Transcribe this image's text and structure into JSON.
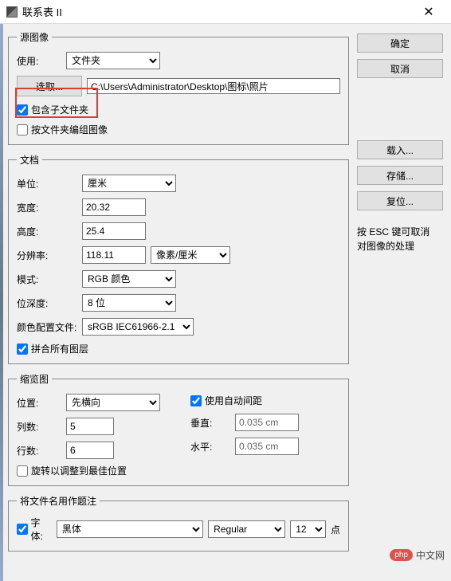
{
  "window": {
    "title": "联系表 II",
    "close": "✕"
  },
  "buttons": {
    "ok": "确定",
    "cancel": "取消",
    "load": "载入...",
    "save": "存储...",
    "reset": "复位...",
    "select": "选取..."
  },
  "hint": {
    "line1": "按 ESC 键可取消",
    "line2": "对图像的处理"
  },
  "source": {
    "legend": "源图像",
    "use_label": "使用:",
    "use_value": "文件夹",
    "path": "C:\\Users\\Administrator\\Desktop\\图标\\照片",
    "include_sub": "包含子文件夹",
    "group_by_folder": "按文件夹编组图像"
  },
  "doc": {
    "legend": "文档",
    "unit_label": "单位:",
    "unit_value": "厘米",
    "width_label": "宽度:",
    "width_value": "20.32",
    "height_label": "高度:",
    "height_value": "25.4",
    "res_label": "分辨率:",
    "res_value": "118.11",
    "res_unit": "像素/厘米",
    "mode_label": "模式:",
    "mode_value": "RGB 颜色",
    "depth_label": "位深度:",
    "depth_value": "8 位",
    "profile_label": "颜色配置文件:",
    "profile_value": "sRGB IEC61966-2.1",
    "flatten": "拼合所有图层"
  },
  "thumb": {
    "legend": "缩览图",
    "place_label": "位置:",
    "place_value": "先横向",
    "auto_spacing": "使用自动间距",
    "cols_label": "列数:",
    "cols_value": "5",
    "rows_label": "行数:",
    "rows_value": "6",
    "vert_label": "垂直:",
    "vert_value": "0.035 cm",
    "horiz_label": "水平:",
    "horiz_value": "0.035 cm",
    "rotate": "旋转以调整到最佳位置"
  },
  "caption": {
    "legend": "将文件名用作题注",
    "font_label": "字体:",
    "font_value": "黑体",
    "style_value": "Regular",
    "size_value": "12",
    "size_suffix": "点"
  },
  "watermark": {
    "badge": "php",
    "text": "中文网"
  }
}
